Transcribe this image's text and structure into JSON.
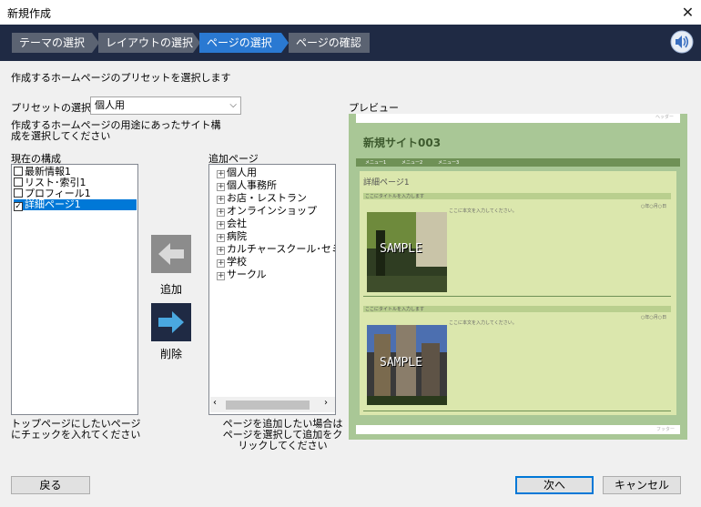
{
  "window": {
    "title": "新規作成",
    "close_glyph": "✕"
  },
  "steps": [
    {
      "label": "テーマの選択",
      "active": false
    },
    {
      "label": "レイアウトの選択",
      "active": false
    },
    {
      "label": "ページの選択",
      "active": true
    },
    {
      "label": "ページの確認",
      "active": false
    }
  ],
  "instructions": "作成するホームページのプリセットを選択します",
  "preset": {
    "label": "プリセットの選択",
    "value": "個人用"
  },
  "purpose_text": "作成するホームページの用途にあったサイト構成を選択してください",
  "current": {
    "label": "現在の構成",
    "items": [
      {
        "label": "最新情報1",
        "checked": false,
        "selected": false
      },
      {
        "label": "リスト･索引1",
        "checked": false,
        "selected": false
      },
      {
        "label": "プロフィール1",
        "checked": false,
        "selected": false
      },
      {
        "label": "詳細ページ1",
        "checked": true,
        "selected": true
      }
    ],
    "hint": "トップページにしたいページにチェックを入れてください"
  },
  "add_pages": {
    "label": "追加ページ",
    "items": [
      "個人用",
      "個人事務所",
      "お店・レストラン",
      "オンラインショップ",
      "会社",
      "病院",
      "カルチャースクール･セミナー",
      "学校",
      "サークル"
    ],
    "hint": "ページを追加したい場合はページを選択して追加をクリックしてください"
  },
  "actions": {
    "add_label": "追加",
    "delete_label": "削除"
  },
  "preview": {
    "label": "プレビュー",
    "header_text": "ヘッダー",
    "site_title": "新規サイト003",
    "menu": [
      "メニュー1",
      "メニュー2",
      "メニュー3"
    ],
    "page_title": "詳細ページ1",
    "section_title": "ここにタイトルを入力します",
    "date": "○年○月○日",
    "body_lead": "ここに本文を入力してください。",
    "sample_text": "SAMPLE",
    "footer_text": "フッター"
  },
  "buttons": {
    "back": "戻る",
    "next": "次へ",
    "cancel": "キャンセル"
  },
  "colors": {
    "accent": "#2a79d2",
    "stepbar": "#1f2a44",
    "preview_bg": "#a9c796"
  }
}
